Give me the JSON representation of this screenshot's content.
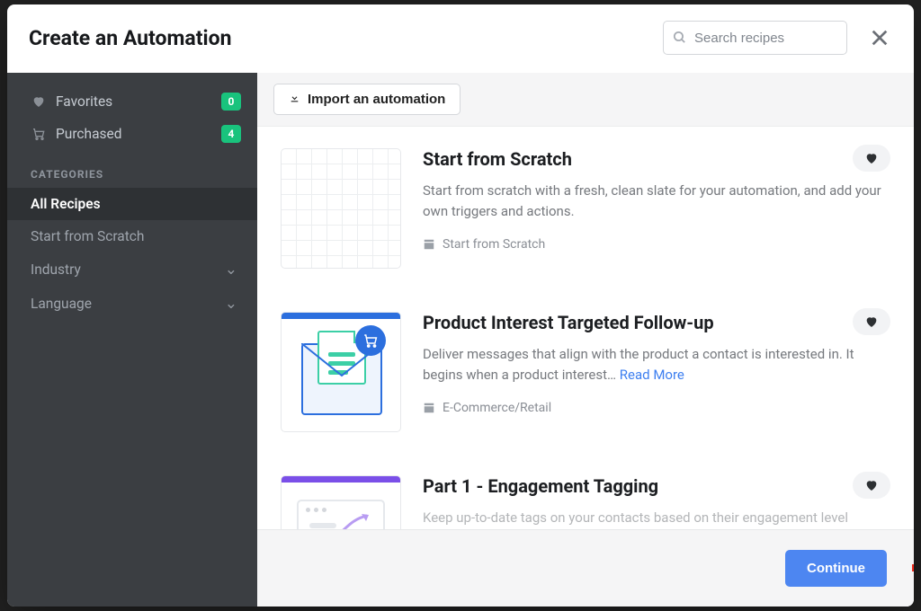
{
  "header": {
    "title": "Create an Automation",
    "search_placeholder": "Search recipes"
  },
  "sidebar": {
    "favorites": {
      "label": "Favorites",
      "count": "0"
    },
    "purchased": {
      "label": "Purchased",
      "count": "4"
    },
    "categories_heading": "CATEGORIES",
    "cats": [
      {
        "label": "All Recipes",
        "active": true
      },
      {
        "label": "Start from Scratch"
      },
      {
        "label": "Industry",
        "expandable": true
      },
      {
        "label": "Language",
        "expandable": true
      }
    ]
  },
  "toolbar": {
    "import_label": "Import an automation"
  },
  "recipes": [
    {
      "title": "Start from Scratch",
      "desc": "Start from scratch with a fresh, clean slate for your automation, and add your own triggers and actions.",
      "category": "Start from Scratch"
    },
    {
      "title": "Product Interest Targeted Follow-up",
      "desc": "Deliver messages that align with the product a contact is interested in. It begins when a product interest… ",
      "read_more": "Read More",
      "category": "E-Commerce/Retail"
    },
    {
      "title": "Part 1 - Engagement Tagging",
      "desc": "Keep up-to-date tags on your contacts based on their engagement level",
      "category": ""
    }
  ],
  "footer": {
    "continue_label": "Continue"
  }
}
